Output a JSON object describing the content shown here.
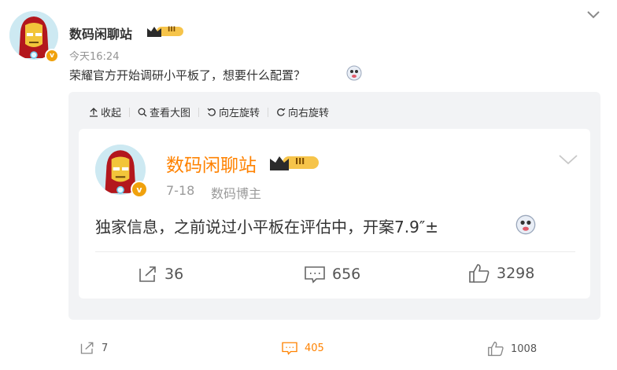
{
  "post": {
    "author": "数码闲聊站",
    "time": "今天16:24",
    "text": "荣耀官方开始调研小平板了，想要什么配置？",
    "level_badge": "III",
    "verified_mark": "v"
  },
  "toolbar": {
    "collapse": "收起",
    "view_large": "查看大图",
    "rotate_left": "向左旋转",
    "rotate_right": "向右旋转"
  },
  "quoted": {
    "author": "数码闲聊站",
    "date": "7-18",
    "role": "数码博主",
    "text": "独家信息，之前说过小平板在评估中，开案7.9″±",
    "level_badge": "III",
    "verified_mark": "v",
    "reposts": "36",
    "comments": "656",
    "likes": "3298"
  },
  "footer": {
    "reposts": "7",
    "comments": "405",
    "likes": "1008"
  },
  "colors": {
    "accent_orange": "#ff8200",
    "verified_badge": "#f0a10c",
    "quote_bg": "#f2f3f5"
  },
  "icons": [
    "chevron-down-icon",
    "collapse-icon",
    "magnify-icon",
    "rotate-left-icon",
    "rotate-right-icon",
    "repost-icon",
    "comment-icon",
    "like-icon",
    "emoji-icon"
  ]
}
